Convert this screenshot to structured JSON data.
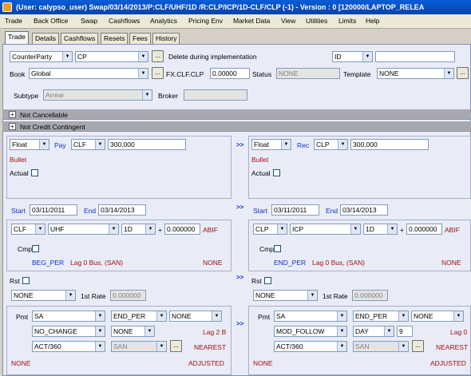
{
  "window": {
    "title": "(User: calypso_user) Swap/03/14/2013/P:CLF/UHF/1D /R:CLP/ICP/1D-CLF/CLP (-1) - Version : 0 [120000/LAPTOP_RELEA"
  },
  "menu": [
    "Trade",
    "Back Office",
    "Swap",
    "Cashflows",
    "Analytics",
    "Pricing Env",
    "Market Data",
    "View",
    "Utilities",
    "Limits",
    "Help"
  ],
  "tabs": [
    "Trade",
    "Details",
    "Cashflows",
    "Resets",
    "Fees",
    "History"
  ],
  "header": {
    "counterparty_type": "CounterParty",
    "counterparty": "CP",
    "counterparty_note": "Delete during implementation",
    "id_select": "ID",
    "id_value": "",
    "book_label": "Book",
    "book": "Global",
    "fx_label": "FX.CLF.CLP",
    "fx_value": "0.00000",
    "status_label": "Status",
    "status": "NONE",
    "template_label": "Template",
    "template": "NONE",
    "subtype_label": "Subtype",
    "subtype": "Arrear",
    "broker_label": "Broker",
    "broker": ""
  },
  "flags": {
    "not_cancellable": "Not Cancellable",
    "not_credit_contingent": "Not Credit Contingent"
  },
  "arrows": ">>",
  "ellipsis": "...",
  "pay_leg": {
    "type": "Float",
    "direction": "Pay",
    "currency": "CLF",
    "notional": "300,000",
    "amortization": "Bullet",
    "actual_label": "Actual",
    "start_label": "Start",
    "start": "03/11/2011",
    "end_label": "End",
    "end": "03/14/2013",
    "ccy2": "CLF",
    "index": "UHF",
    "tenor": "1D",
    "plus": "+",
    "spread": "0.000000",
    "spread_type": "ABIF",
    "cmp_label": "Cmp",
    "beg": "BEG_PER",
    "lag": "Lag 0 Bus, (SAN)",
    "lag_none": "NONE",
    "rst_label": "Rst",
    "rst_select": "NONE",
    "first_rate_label": "1st Rate",
    "first_rate": "0.000000",
    "pmt_label": "Pmt",
    "pmt_freq": "SA",
    "pmt_per": "END_PER",
    "pmt_extra": "NONE",
    "roll": "NO_CHANGE",
    "roll2": "NONE",
    "lag2": "Lag 2 B",
    "daycount": "ACT/360",
    "calendar": "SAN",
    "rounding": "NEAREST",
    "footer_left": "NONE",
    "footer_right": "ADJUSTED"
  },
  "rec_leg": {
    "type": "Float",
    "direction": "Rec",
    "currency": "CLP",
    "notional": "300,000",
    "amortization": "Bullet",
    "actual_label": "Actual",
    "start_label": "Start",
    "start": "03/11/2011",
    "end_label": "End",
    "end": "03/14/2013",
    "ccy2": "CLP",
    "index": "ICP",
    "tenor": "1D",
    "plus": "+",
    "spread": "0.000000",
    "spread_type": "ABIF",
    "cmp_label": "Cmp",
    "beg": "END_PER",
    "lag": "Lag 0 Bus, (SAN)",
    "lag_none": "NONE",
    "rst_label": "Rst",
    "rst_select": "NONE",
    "first_rate_label": "1st Rate",
    "first_rate": "0.000000",
    "pmt_label": "Pmt",
    "pmt_freq": "SA",
    "pmt_per": "END_PER",
    "pmt_extra": "NONE",
    "roll": "MOD_FOLLOW",
    "roll2": "DAY",
    "roll_value": "9",
    "lag2": "Lag 0",
    "daycount": "ACT/360",
    "calendar": "SAN",
    "rounding": "NEAREST",
    "footer_left": "NONE",
    "footer_right": "ADJUSTED"
  }
}
